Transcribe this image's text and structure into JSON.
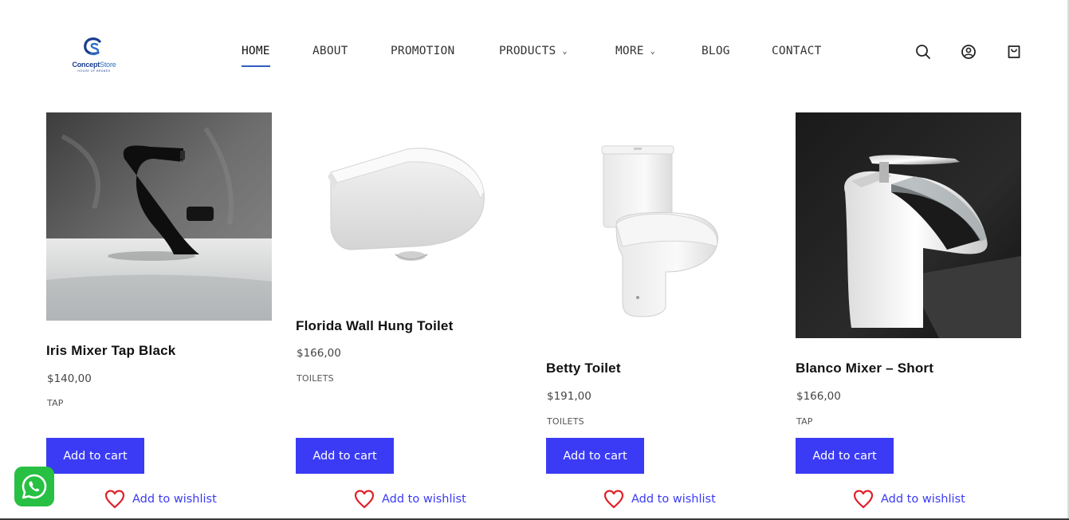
{
  "header": {
    "logo": {
      "text_bold": "Concept",
      "text_light": "Store",
      "subtitle": "HOUSE OF BRANDS"
    },
    "nav": [
      {
        "label": "HOME",
        "active": true
      },
      {
        "label": "ABOUT"
      },
      {
        "label": "PROMOTION"
      },
      {
        "label": "PRODUCTS",
        "has_dropdown": true
      },
      {
        "label": "MORE",
        "has_dropdown": true
      },
      {
        "label": "BLOG"
      },
      {
        "label": "CONTACT"
      }
    ],
    "icons": [
      "search-icon",
      "account-icon",
      "cart-icon"
    ]
  },
  "products": [
    {
      "name": "Iris Mixer Tap Black",
      "price": "$140,00",
      "category": "TAP",
      "button": "Add to cart",
      "wishlist": "Add to wishlist"
    },
    {
      "name": "Florida Wall Hung Toilet",
      "price": "$166,00",
      "category": "TOILETS",
      "button": "Add to cart",
      "wishlist": "Add to wishlist"
    },
    {
      "name": "Betty Toilet",
      "price": "$191,00",
      "category": "TOILETS",
      "button": "Add to cart",
      "wishlist": "Add to wishlist"
    },
    {
      "name": "Blanco Mixer – Short",
      "price": "$166,00",
      "category": "TAP",
      "button": "Add to cart",
      "wishlist": "Add to wishlist"
    }
  ],
  "colors": {
    "accent": "#3b3bf5",
    "nav_underline": "#2f5fbf",
    "heart": "#e0202a",
    "whatsapp": "#28c043"
  },
  "floating": {
    "icon": "whatsapp-icon"
  }
}
